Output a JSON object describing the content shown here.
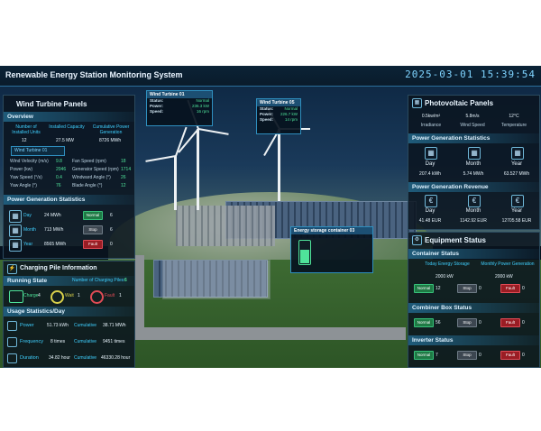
{
  "title": "Renewable Energy Station Monitoring System",
  "clock": "2025-03-01 15:39:54",
  "colors": {
    "accent": "#3fd0ff",
    "good": "#4fe39a",
    "warn": "#d9d04a",
    "stop": "#9a1d24"
  },
  "wind": {
    "title": "Wind Turbine Panels",
    "overview_title": "Overview",
    "overview": [
      {
        "label": "Number of Installed Units",
        "value": "12"
      },
      {
        "label": "Installed Capacity",
        "value": "27.5 MW"
      },
      {
        "label": "Cumulative Power Generation",
        "value": "8726 MWh"
      }
    ],
    "turbine_tab": "Wind Turbine 01",
    "params_left": [
      {
        "label": "Wind Velocity (m/s)",
        "value": "9.8"
      },
      {
        "label": "Power (kw)",
        "value": "2046"
      },
      {
        "label": "Yaw Speed (°/s)",
        "value": "0.4"
      },
      {
        "label": "Yaw Angle (°)",
        "value": "76"
      }
    ],
    "params_right": [
      {
        "label": "Fan Speed (rpm)",
        "value": "18"
      },
      {
        "label": "Generator Speed (rpm)",
        "value": "1714"
      },
      {
        "label": "Windward Angle (°)",
        "value": "26"
      },
      {
        "label": "Blade Angle (°)",
        "value": "12"
      }
    ],
    "gen_title": "Power Generation Statistics",
    "gen": [
      {
        "period": "Day",
        "value": "24 MWh",
        "btn": "Normal",
        "num": "6"
      },
      {
        "period": "Month",
        "value": "713 MWh",
        "btn": "Stop",
        "num": "6"
      },
      {
        "period": "Year",
        "value": "8565 MWh",
        "btn": "Fault",
        "num": "0"
      }
    ]
  },
  "charging": {
    "title": "Charging Pile Information",
    "running_title": "Running State",
    "piles_label": "Number of Charging Piles:",
    "piles_value": "6",
    "states": [
      {
        "label": "Charge",
        "count": "4"
      },
      {
        "label": "Wait",
        "count": "1"
      },
      {
        "label": "Fault",
        "count": "1"
      }
    ],
    "usage_title": "Usage Statistics/Day",
    "usage": [
      {
        "label": "Power",
        "day": "51.73 kWh",
        "cum_label": "Cumulative",
        "cum": "38.71 MWh"
      },
      {
        "label": "Frequency",
        "day": "8 times",
        "cum_label": "Cumulative",
        "cum": "9451 times"
      },
      {
        "label": "Duration",
        "day": "34.82 hour",
        "cum_label": "Cumulative",
        "cum": "46330.28 hour"
      }
    ]
  },
  "callouts": [
    {
      "name": "Wind Turbine 01",
      "rows": [
        {
          "k": "Status:",
          "v": "Normal"
        },
        {
          "k": "Power:",
          "v": "236.3 kW"
        },
        {
          "k": "Speed:",
          "v": "16 rpm"
        }
      ]
    },
    {
      "name": "Wind Turbine 05",
      "rows": [
        {
          "k": "Status:",
          "v": "Normal"
        },
        {
          "k": "Power:",
          "v": "226.7 kW"
        },
        {
          "k": "Speed:",
          "v": "14 rpm"
        }
      ]
    }
  ],
  "storage": {
    "name": "Energy storage container 03"
  },
  "pv": {
    "title": "Photovoltaic Panels",
    "weather": [
      {
        "value": "0.5kw/m²",
        "label": "Irradiance"
      },
      {
        "value": "5.8m/s",
        "label": "Wind Speed"
      },
      {
        "value": "12°C",
        "label": "Temperature"
      }
    ],
    "gen_title": "Power Generation Statistics",
    "gen": [
      {
        "label": "Day",
        "value": "207.4 kWh"
      },
      {
        "label": "Month",
        "value": "5.74 MWh"
      },
      {
        "label": "Year",
        "value": "63.527 MWh"
      }
    ],
    "rev_title": "Power Generation Revenue",
    "rev": [
      {
        "label": "Day",
        "value": "41.48 EUR"
      },
      {
        "label": "Month",
        "value": "1142.92 EUR"
      },
      {
        "label": "Year",
        "value": "12705.58 EUR"
      }
    ]
  },
  "equipment": {
    "title": "Equipment Status",
    "container_title": "Container Status",
    "container_stats": [
      {
        "label": "Today Energy Storage",
        "value": "2000 kW"
      },
      {
        "label": "Monthly Power Generation",
        "value": "2000 kW"
      }
    ],
    "container_btns": [
      {
        "label": "Normal",
        "num": "12"
      },
      {
        "label": "Stop",
        "num": "0"
      },
      {
        "label": "Fault",
        "num": "0"
      }
    ],
    "combiner_title": "Combiner Box Status",
    "combiner_btns": [
      {
        "label": "Normal",
        "num": "56"
      },
      {
        "label": "Stop",
        "num": "0"
      },
      {
        "label": "Fault",
        "num": "0"
      }
    ],
    "inverter_title": "Inverter Status",
    "inverter_btns": [
      {
        "label": "Normal",
        "num": "7"
      },
      {
        "label": "Stop",
        "num": "0"
      },
      {
        "label": "Fault",
        "num": "0"
      }
    ]
  }
}
